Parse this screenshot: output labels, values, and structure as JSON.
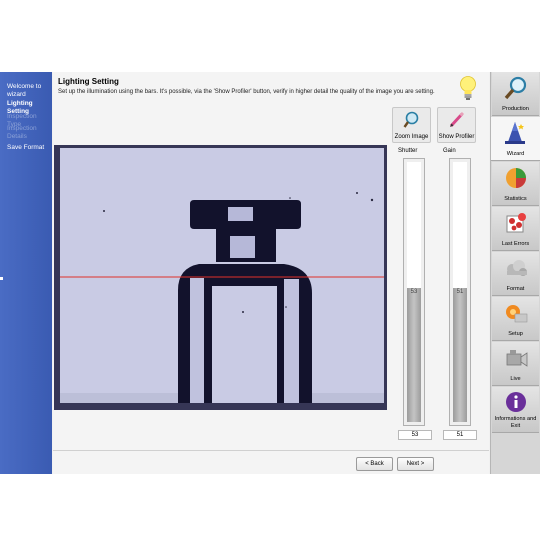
{
  "sidebar": {
    "steps": [
      {
        "label": "Welcome to wizard",
        "state": "normal"
      },
      {
        "label": "Lighting Setting",
        "state": "active"
      },
      {
        "label": "Inspection Type",
        "state": "disabled"
      },
      {
        "label": "Inspection Details",
        "state": "disabled"
      },
      {
        "label": "Save Format",
        "state": "normal"
      }
    ]
  },
  "main": {
    "title": "Lighting Setting",
    "description": "Set up the illumination using the bars. It's possible, via the 'Show Profiler' button, verify in higher detail the quality of the image you are setting.",
    "tools": {
      "zoom_label": "Zoom Image",
      "profiler_label": "Show Profiler"
    },
    "bars": {
      "shutter": {
        "label": "Shutter",
        "value": "53",
        "level": 0.53
      },
      "gain": {
        "label": "Gain",
        "value": "51",
        "level": 0.51
      }
    },
    "nav": {
      "back_label": "< Back",
      "next_label": "Next >"
    }
  },
  "rightnav": {
    "items": [
      {
        "label": "Production",
        "icon": "magnifier-icon"
      },
      {
        "label": "Wizard",
        "icon": "wizard-hat-icon",
        "selected": true
      },
      {
        "label": "Statistics",
        "icon": "pie-chart-icon"
      },
      {
        "label": "Last Errors",
        "icon": "errors-icon"
      },
      {
        "label": "Format",
        "icon": "format-icon"
      },
      {
        "label": "Setup",
        "icon": "setup-icon"
      },
      {
        "label": "Live",
        "icon": "camera-icon"
      },
      {
        "label": "Informations and Exit",
        "icon": "info-icon"
      }
    ]
  },
  "colors": {
    "sidebar": "#3f61b9",
    "camera_background": "#c9cbe4",
    "profile_line": "#e0302a",
    "info_purple": "#6a2f9a"
  }
}
